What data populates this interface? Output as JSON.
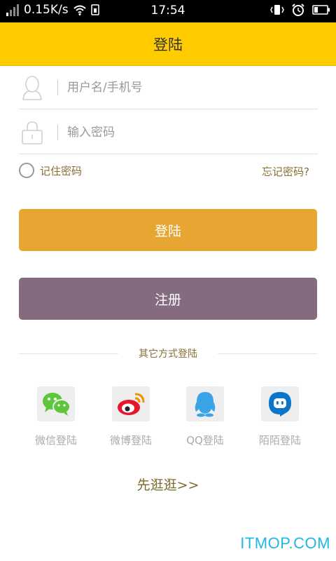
{
  "status_bar": {
    "network_speed": "0.15K/s",
    "time": "17:54"
  },
  "header": {
    "title": "登陆"
  },
  "form": {
    "username_placeholder": "用户名/手机号",
    "password_placeholder": "输入密码",
    "remember_label": "记住密码",
    "forgot_label": "忘记密码?"
  },
  "buttons": {
    "login_label": "登陆",
    "register_label": "注册"
  },
  "other_login": {
    "label": "其它方式登陆",
    "items": [
      {
        "label": "微信登陆",
        "icon": "wechat-icon",
        "color": "#5dc63b"
      },
      {
        "label": "微博登陆",
        "icon": "weibo-icon",
        "color": "#e6162d"
      },
      {
        "label": "QQ登陆",
        "icon": "qq-icon",
        "color": "#3aa4e7"
      },
      {
        "label": "陌陌登陆",
        "icon": "momo-icon",
        "color": "#0a75c9"
      }
    ]
  },
  "browse_label": "先逛逛>>",
  "watermark": "ITMOP.COM",
  "colors": {
    "header": "#ffcc00",
    "login_button": "#e7a631",
    "register_button": "#856b80",
    "accent_text": "#8a7034"
  }
}
